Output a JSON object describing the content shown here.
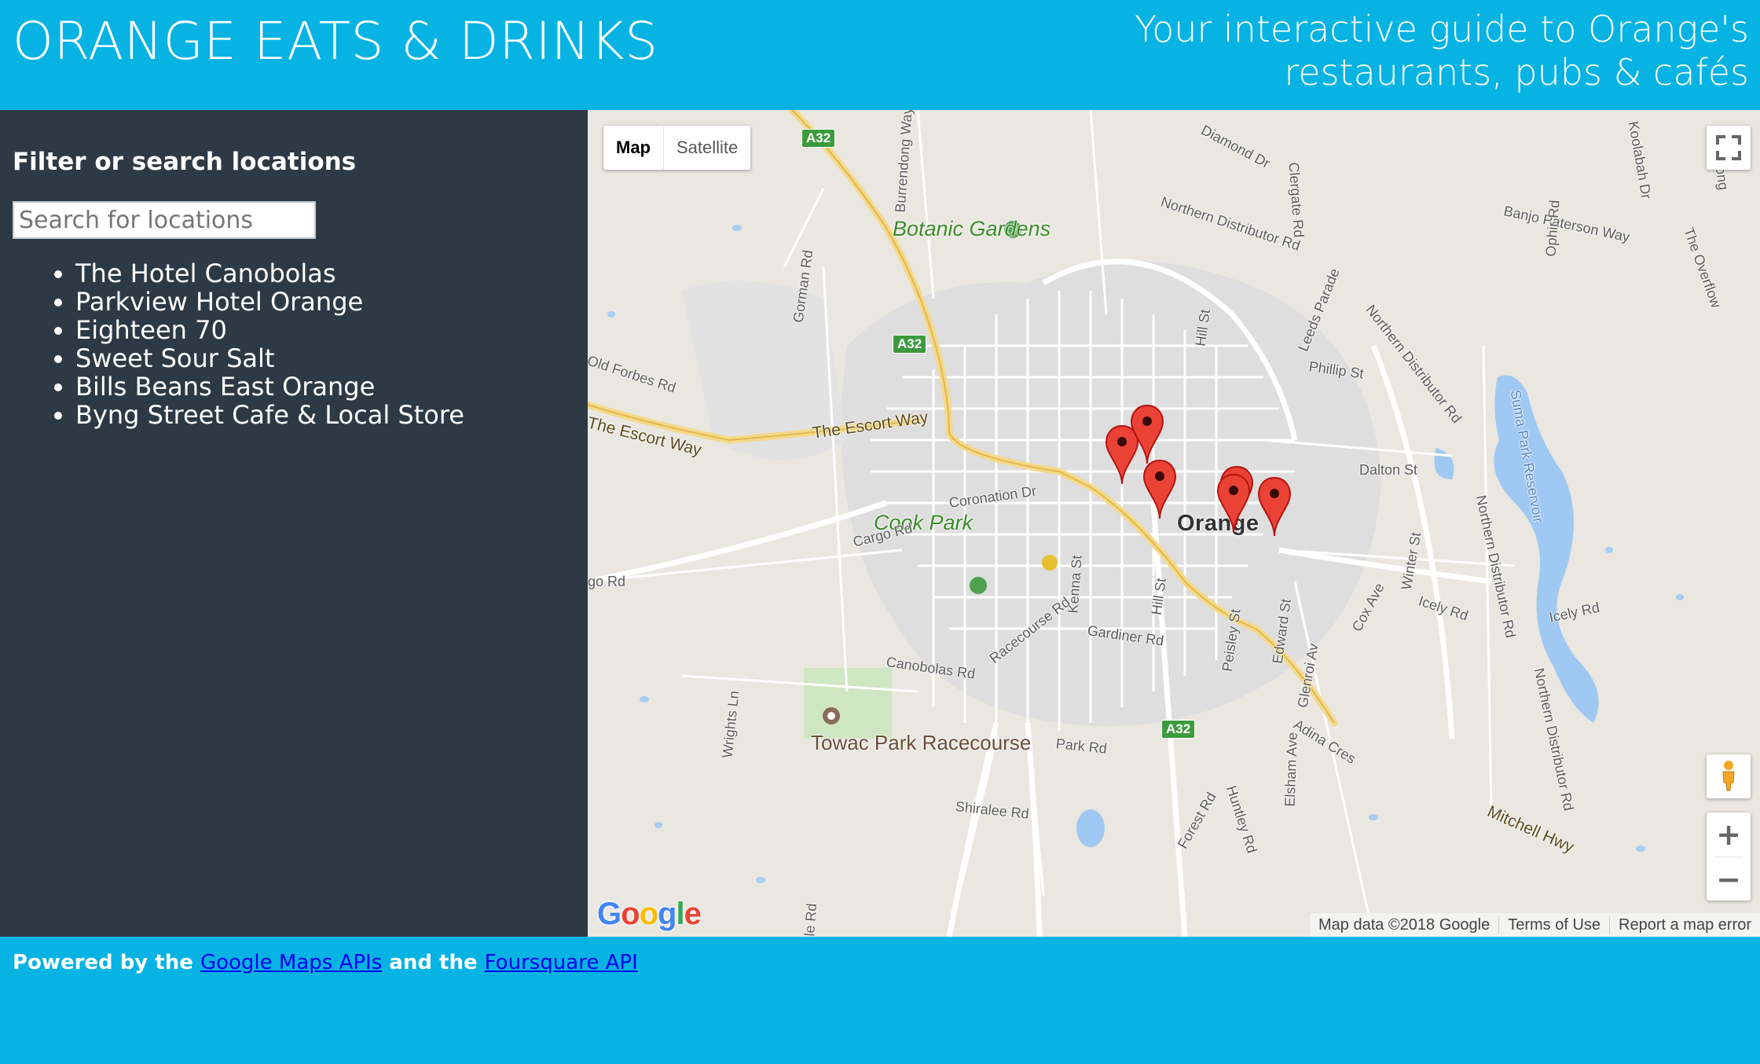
{
  "header": {
    "title": "ORANGE EATS & DRINKS",
    "tagline": "Your interactive guide to Orange's restaurants, pubs & cafés"
  },
  "sidebar": {
    "heading": "Filter or search locations",
    "search_placeholder": "Search for locations",
    "search_value": "",
    "locations": [
      "The Hotel Canobolas",
      "Parkview Hotel Orange",
      "Eighteen 70",
      "Sweet Sour Salt",
      "Bills Beans East Orange",
      "Byng Street Cafe & Local Store"
    ]
  },
  "map": {
    "type_control": {
      "map": "Map",
      "satellite": "Satellite",
      "selected": "Map"
    },
    "zoom_in": "+",
    "zoom_out": "−",
    "logo": "Google",
    "attribution": {
      "data": "Map data ©2018 Google",
      "terms": "Terms of Use",
      "report": "Report a map error"
    },
    "labels": {
      "botanic": "Botanic Gardens",
      "cook_park": "Cook Park",
      "orange": "Orange",
      "towac": "Towac Park Racecourse",
      "escort_way_1": "The Escort Way",
      "escort_way_2": "The Escort Way",
      "mitchell": "Mitchell Hwy",
      "northern_dist_top": "Northern Distributor Rd",
      "northern_dist_right": "Northern Distributor Rd",
      "northern_dist_right2": "Northern Distributor Rd",
      "northern_dist_mid": "Northern Distributor Rd",
      "suma": "Suma Park Reservoir",
      "banjo": "Banjo Paterson Way",
      "dalton": "Dalton St",
      "coronation": "Coronation Dr",
      "cargo": "Cargo Rd",
      "gardiner": "Gardiner Rd",
      "racecourse": "Racecourse Rd",
      "canobolas": "Canobolas Rd",
      "park": "Park Rd",
      "shiralee": "Shiralee Rd",
      "forest": "Forest Rd",
      "huntley": "Huntley Rd",
      "peisley": "Peisley St",
      "edward": "Edward St",
      "elsham": "Elsham Ave",
      "adina": "Adina Cres",
      "glenroi": "Glenroi Av",
      "coxave": "Cox Ave",
      "winter": "Winter St",
      "icely_rd": "Icely Rd",
      "icely_rd2": "Icely Rd",
      "hill_top": "Hill St",
      "hill_bot": "Hill St",
      "kenna": "Kenna St",
      "phillip": "Phillip St",
      "leeds": "Leeds Parade",
      "clergate": "Clergate Rd",
      "diamond": "Diamond Dr",
      "gorman": "Gorman Rd",
      "wrights": "Wrights Ln",
      "forbes": "Old Forbes Rd",
      "go_rd": "go Rd",
      "ophir": "Ophir Rd",
      "overflow": "The Overflow",
      "koolabah": "Koolabah Dr",
      "strib": "Strib bong",
      "burrendong": "Burrendong Way",
      "cle_rd": "cle Rd",
      "a32_1": "A32",
      "a32_2": "A32",
      "a32_3": "A32"
    },
    "marker_count": 6
  },
  "footer": {
    "prefix": "Powered by the ",
    "link1": "Google Maps APIs",
    "middle": " and the ",
    "link2": "Foursquare API"
  }
}
